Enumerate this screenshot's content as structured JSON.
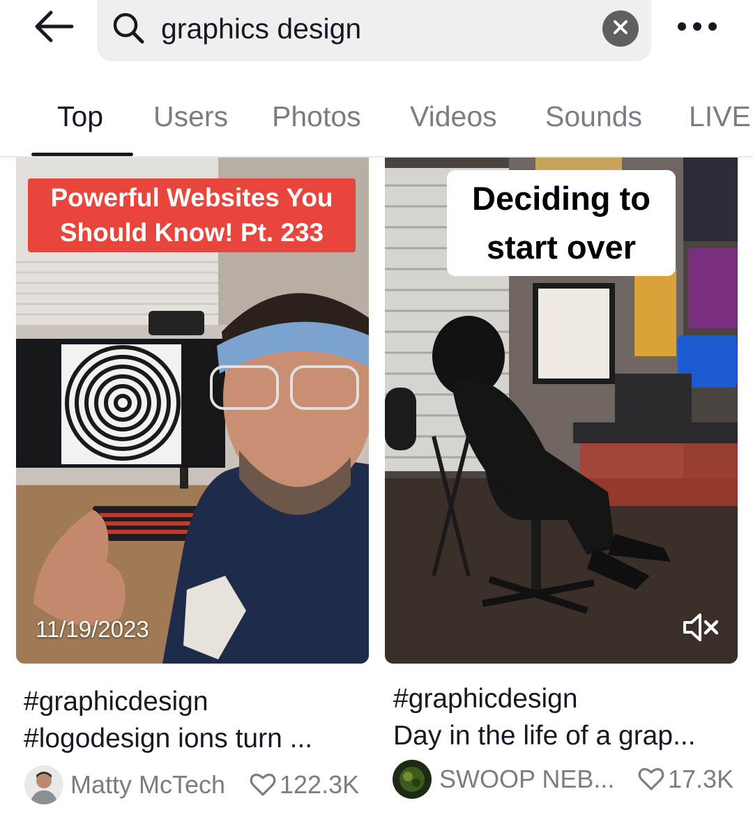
{
  "search": {
    "query": "graphics design",
    "back_icon": "arrow-left-icon",
    "search_icon": "magnifier-icon",
    "clear_icon": "close-icon",
    "more_icon": "more-horizontal-icon"
  },
  "tabs": [
    {
      "label": "Top",
      "active": true
    },
    {
      "label": "Users",
      "active": false
    },
    {
      "label": "Photos",
      "active": false
    },
    {
      "label": "Videos",
      "active": false
    },
    {
      "label": "Sounds",
      "active": false
    },
    {
      "label": "LIVE",
      "active": false
    }
  ],
  "results": [
    {
      "overlay_text_line1": "Powerful Websites You",
      "overlay_text_line2": "Should Know! Pt. 233",
      "date": "11/19/2023",
      "caption_line1": "#graphicdesign",
      "caption_line2": "#logodesign ions turn ...",
      "author": "Matty McTech",
      "likes": "122.3K"
    },
    {
      "overlay_text_line1": "Deciding to",
      "overlay_text_line2": "start over",
      "caption_line1": "#graphicdesign",
      "caption_line2": "Day in the life of a grap...",
      "author": "SWOOP NEB...",
      "likes": "17.3K",
      "mute_icon": "speaker-muted-icon"
    }
  ],
  "colors": {
    "text_primary": "#161823",
    "text_secondary": "#7b7d84",
    "search_bg": "#efefef",
    "overlay_red": "#e8453c"
  }
}
